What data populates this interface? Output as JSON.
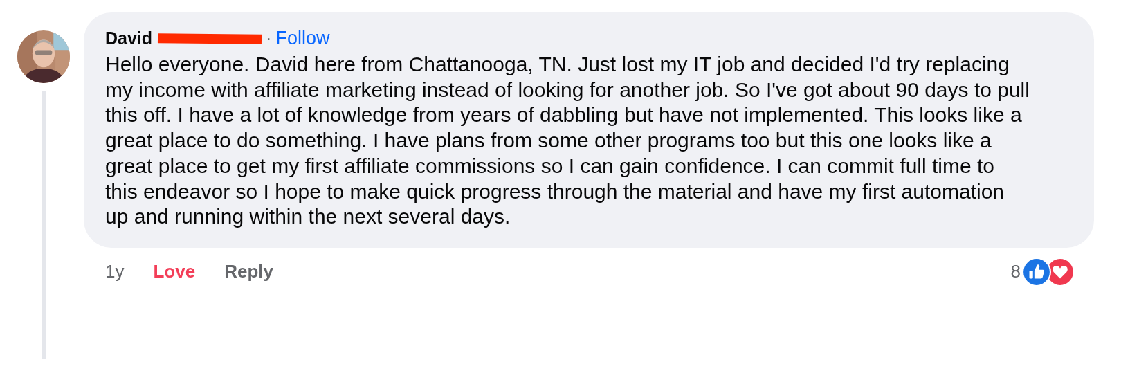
{
  "comment": {
    "author": {
      "name": "David",
      "name_redacted": true,
      "separator": "·",
      "follow": "Follow"
    },
    "text": "Hello everyone. David here from Chattanooga, TN. Just lost my IT job and decided I'd try replacing my income with affiliate marketing instead of looking for another job. So I've got about 90 days to pull this off. I have a lot of knowledge from years of dabbling but have not implemented. This looks like a great place to do something. I have plans from some other programs too but this one looks like a great place to get my first affiliate commissions so I can gain confidence. I can commit full time to this endeavor so I hope to make quick progress through the material and have my first automation up and running within the next several days.",
    "time": "1y",
    "actions": [
      {
        "label": "Love",
        "kind": "reaction",
        "active": true
      },
      {
        "label": "Reply",
        "kind": "reply"
      }
    ],
    "reaction_count": "8",
    "reactions": [
      {
        "kind": "like"
      },
      {
        "kind": "love"
      }
    ]
  }
}
